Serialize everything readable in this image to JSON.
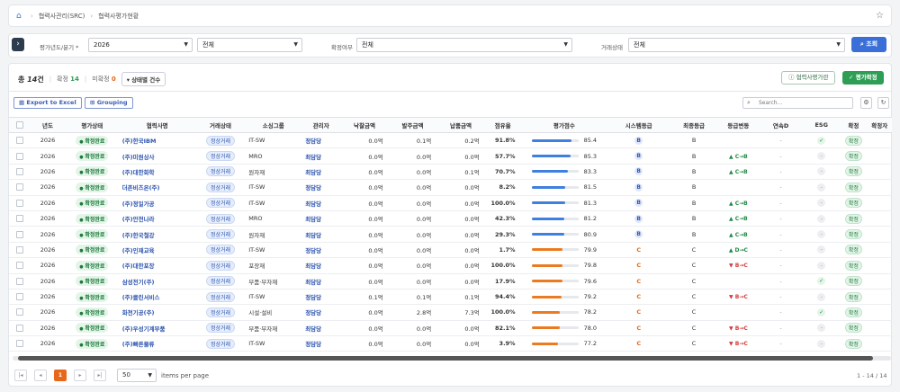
{
  "breadcrumb": {
    "items": [
      "협력사관리(SRC)",
      "협력사평가현황"
    ]
  },
  "filter": {
    "year_label": "평가년도/분기 *",
    "year_value": "2026",
    "quarter_value": "전체",
    "confirm_label": "확정여부",
    "confirm_value": "전체",
    "deal_label": "거래상태",
    "deal_value": "전체",
    "search_button": "조회"
  },
  "summary": {
    "total_prefix": "총",
    "total_count": "14",
    "total_suffix": "건",
    "confirmed_label": "확정",
    "confirmed_count": "14",
    "unconfirmed_label": "미확정",
    "unconfirmed_count": "0",
    "status_count_button": "상태별 건수"
  },
  "actions": {
    "guide_button": "협력사평가란",
    "eval_button": "평가확정"
  },
  "toolbar": {
    "export_button": "Export to Excel",
    "grouping_button": "Grouping",
    "search_placeholder": "Search..."
  },
  "columns": [
    "년도",
    "평가상태",
    "협력사명",
    "거래상태",
    "소싱그룹",
    "관리자",
    "낙찰금액",
    "발주금액",
    "납품금액",
    "점유율",
    "평가점수",
    "시스템등급",
    "최종등급",
    "등급변동",
    "연속D",
    "ESG",
    "확정",
    "확정자"
  ],
  "rows": [
    {
      "year": "2026",
      "status": "확정완료",
      "company": "(주)한국IBM",
      "deal": "정상거래",
      "group": "IT-SW",
      "manager": "정담당",
      "bid": "0.0억",
      "order": "0.1억",
      "delivery": "0.2억",
      "share": "91.8%",
      "score": 85.4,
      "sys": "B",
      "final": "B",
      "change": "",
      "esg": "ok",
      "confirm": "확정"
    },
    {
      "year": "2026",
      "status": "확정완료",
      "company": "(주)미원상사",
      "deal": "정상거래",
      "group": "MRO",
      "manager": "최담당",
      "bid": "0.0억",
      "order": "0.0억",
      "delivery": "0.0억",
      "share": "57.7%",
      "score": 85.3,
      "sys": "B",
      "final": "B",
      "change": "▲ C→B",
      "esg": "-",
      "confirm": "확정"
    },
    {
      "year": "2026",
      "status": "확정완료",
      "company": "(주)대한화학",
      "deal": "정상거래",
      "group": "원자재",
      "manager": "최담당",
      "bid": "0.0억",
      "order": "0.0억",
      "delivery": "0.1억",
      "share": "70.7%",
      "score": 83.3,
      "sys": "B",
      "final": "B",
      "change": "▲ C→B",
      "esg": "-",
      "confirm": "확정"
    },
    {
      "year": "2026",
      "status": "확정완료",
      "company": "더존비즈온(주)",
      "deal": "정상거래",
      "group": "IT-SW",
      "manager": "정담당",
      "bid": "0.0억",
      "order": "0.0억",
      "delivery": "0.0억",
      "share": "8.2%",
      "score": 81.5,
      "sys": "B",
      "final": "B",
      "change": "",
      "esg": "-",
      "confirm": "확정"
    },
    {
      "year": "2026",
      "status": "확정완료",
      "company": "(주)정일가공",
      "deal": "정상거래",
      "group": "IT-SW",
      "manager": "최담당",
      "bid": "0.0억",
      "order": "0.0억",
      "delivery": "0.0억",
      "share": "100.0%",
      "score": 81.3,
      "sys": "B",
      "final": "B",
      "change": "▲ C→B",
      "esg": "-",
      "confirm": "확정"
    },
    {
      "year": "2026",
      "status": "확정완료",
      "company": "(주)안전나라",
      "deal": "정상거래",
      "group": "MRO",
      "manager": "최담당",
      "bid": "0.0억",
      "order": "0.0억",
      "delivery": "0.0억",
      "share": "42.3%",
      "score": 81.2,
      "sys": "B",
      "final": "B",
      "change": "▲ C→B",
      "esg": "-",
      "confirm": "확정"
    },
    {
      "year": "2026",
      "status": "확정완료",
      "company": "(주)한국철강",
      "deal": "정상거래",
      "group": "원자재",
      "manager": "최담당",
      "bid": "0.0억",
      "order": "0.0억",
      "delivery": "0.0억",
      "share": "29.3%",
      "score": 80.9,
      "sys": "B",
      "final": "B",
      "change": "▲ C→B",
      "esg": "-",
      "confirm": "확정"
    },
    {
      "year": "2026",
      "status": "확정완료",
      "company": "(주)인재교육",
      "deal": "정상거래",
      "group": "IT-SW",
      "manager": "정담당",
      "bid": "0.0억",
      "order": "0.0억",
      "delivery": "0.0억",
      "share": "1.7%",
      "score": 79.9,
      "sys": "C",
      "final": "C",
      "change": "▲ D→C",
      "esg": "-",
      "confirm": "확정"
    },
    {
      "year": "2026",
      "status": "확정완료",
      "company": "(주)대한포장",
      "deal": "정상거래",
      "group": "포장재",
      "manager": "최담당",
      "bid": "0.0억",
      "order": "0.0억",
      "delivery": "0.0억",
      "share": "100.0%",
      "score": 79.8,
      "sys": "C",
      "final": "C",
      "change": "▼ B→C",
      "esg": "-",
      "confirm": "확정"
    },
    {
      "year": "2026",
      "status": "확정완료",
      "company": "삼성전기(주)",
      "deal": "정상거래",
      "group": "부품·부자재",
      "manager": "최담당",
      "bid": "0.0억",
      "order": "0.0억",
      "delivery": "0.0억",
      "share": "17.9%",
      "score": 79.6,
      "sys": "C",
      "final": "C",
      "change": "",
      "esg": "ok",
      "confirm": "확정"
    },
    {
      "year": "2026",
      "status": "확정완료",
      "company": "(주)클린서비스",
      "deal": "정상거래",
      "group": "IT-SW",
      "manager": "정담당",
      "bid": "0.1억",
      "order": "0.1억",
      "delivery": "0.1억",
      "share": "94.4%",
      "score": 79.2,
      "sys": "C",
      "final": "C",
      "change": "▼ B→C",
      "esg": "-",
      "confirm": "확정"
    },
    {
      "year": "2026",
      "status": "확정완료",
      "company": "화천기공(주)",
      "deal": "정상거래",
      "group": "시설·설비",
      "manager": "정담당",
      "bid": "0.0억",
      "order": "2.8억",
      "delivery": "7.3억",
      "share": "100.0%",
      "score": 78.2,
      "sys": "C",
      "final": "C",
      "change": "",
      "esg": "ok",
      "confirm": "확정"
    },
    {
      "year": "2026",
      "status": "확정완료",
      "company": "(주)우성기계부품",
      "deal": "정상거래",
      "group": "부품·부자재",
      "manager": "최담당",
      "bid": "0.0억",
      "order": "0.0억",
      "delivery": "0.0억",
      "share": "82.1%",
      "score": 78.0,
      "sys": "C",
      "final": "C",
      "change": "▼ B→C",
      "esg": "-",
      "confirm": "확정"
    },
    {
      "year": "2026",
      "status": "확정완료",
      "company": "(주)빠른물류",
      "deal": "정상거래",
      "group": "IT-SW",
      "manager": "정담당",
      "bid": "0.0억",
      "order": "0.0억",
      "delivery": "0.0억",
      "share": "3.9%",
      "score": 77.2,
      "sys": "C",
      "final": "C",
      "change": "▼ B→C",
      "esg": "-",
      "confirm": "확정"
    }
  ],
  "pagination": {
    "current": "1",
    "per_page": "50",
    "per_page_label": "items per page",
    "range": "1 - 14 / 14"
  },
  "colors": {
    "accent": "#3b6fd8",
    "green": "#2f9e55",
    "orange": "#e8681b",
    "blue_bar": "#3f7fe0",
    "orange_bar": "#ea7b22"
  }
}
